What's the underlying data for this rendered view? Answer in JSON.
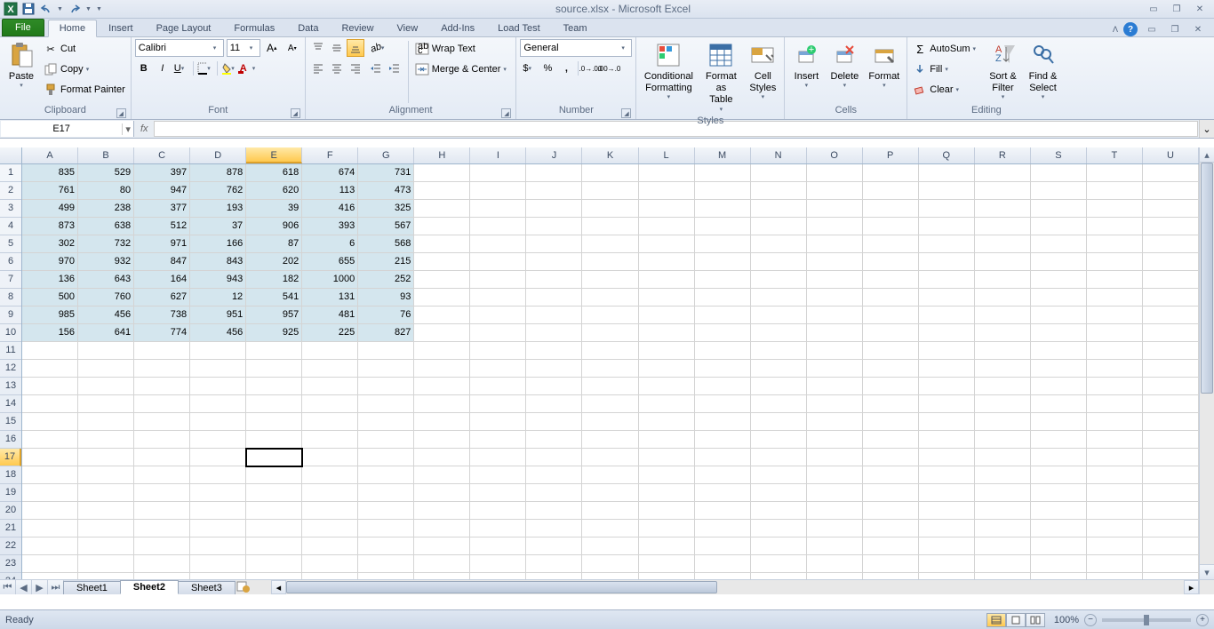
{
  "title": "source.xlsx - Microsoft Excel",
  "tabs": {
    "file": "File",
    "list": [
      "Home",
      "Insert",
      "Page Layout",
      "Formulas",
      "Data",
      "Review",
      "View",
      "Add-Ins",
      "Load Test",
      "Team"
    ],
    "active": "Home"
  },
  "ribbon": {
    "clipboard": {
      "label": "Clipboard",
      "paste": "Paste",
      "cut": "Cut",
      "copy": "Copy",
      "painter": "Format Painter"
    },
    "font": {
      "label": "Font",
      "name": "Calibri",
      "size": "11"
    },
    "alignment": {
      "label": "Alignment",
      "wrap": "Wrap Text",
      "merge": "Merge & Center"
    },
    "number": {
      "label": "Number",
      "format": "General"
    },
    "styles": {
      "label": "Styles",
      "cond": "Conditional Formatting",
      "table": "Format as Table",
      "cell": "Cell Styles"
    },
    "cells": {
      "label": "Cells",
      "insert": "Insert",
      "delete": "Delete",
      "format": "Format"
    },
    "editing": {
      "label": "Editing",
      "autosum": "AutoSum",
      "fill": "Fill",
      "clear": "Clear",
      "sort": "Sort & Filter",
      "find": "Find & Select"
    }
  },
  "namebox": "E17",
  "columns": [
    "A",
    "B",
    "C",
    "D",
    "E",
    "F",
    "G",
    "H",
    "I",
    "J",
    "K",
    "L",
    "M",
    "N",
    "O",
    "P",
    "Q",
    "R",
    "S",
    "T",
    "U"
  ],
  "active_col": "E",
  "active_row": 17,
  "data_rows": 10,
  "data_cols": 7,
  "cells": [
    [
      835,
      529,
      397,
      878,
      618,
      674,
      731
    ],
    [
      761,
      80,
      947,
      762,
      620,
      113,
      473
    ],
    [
      499,
      238,
      377,
      193,
      39,
      416,
      325
    ],
    [
      873,
      638,
      512,
      37,
      906,
      393,
      567
    ],
    [
      302,
      732,
      971,
      166,
      87,
      6,
      568
    ],
    [
      970,
      932,
      847,
      843,
      202,
      655,
      215
    ],
    [
      136,
      643,
      164,
      943,
      182,
      1000,
      252
    ],
    [
      500,
      760,
      627,
      12,
      541,
      131,
      93
    ],
    [
      985,
      456,
      738,
      951,
      957,
      481,
      76
    ],
    [
      156,
      641,
      774,
      456,
      925,
      225,
      827
    ]
  ],
  "sheets": {
    "list": [
      "Sheet1",
      "Sheet2",
      "Sheet3"
    ],
    "active": "Sheet2"
  },
  "status": {
    "ready": "Ready",
    "zoom": "100%"
  }
}
